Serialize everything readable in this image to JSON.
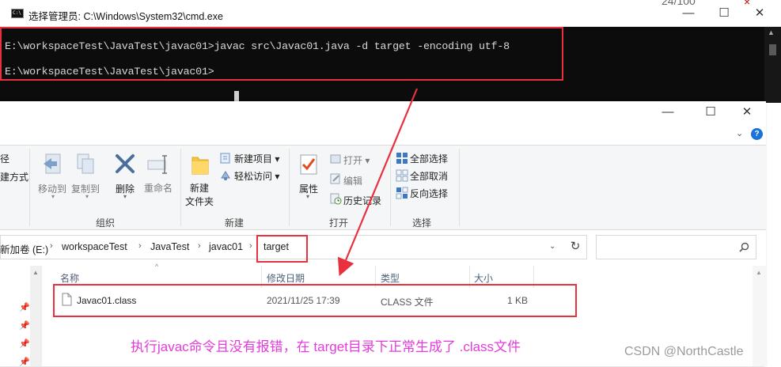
{
  "background_page": {
    "date_fragment": "24/100",
    "close_fragment": "×"
  },
  "cmd": {
    "app_icon_text": "C:\\",
    "title": "选择管理员: C:\\Windows\\System32\\cmd.exe",
    "minimize_glyph": "—",
    "maximize_glyph": "☐",
    "close_glyph": "✕",
    "lines": [
      "E:\\workspaceTest\\JavaTest\\javac01>javac src\\Javac01.java -d target -encoding utf-8",
      "E:\\workspaceTest\\JavaTest\\javac01>"
    ]
  },
  "explorer": {
    "window_controls": {
      "minimize": "—",
      "maximize": "☐",
      "close": "✕"
    },
    "ribbon_toggle": "⌄",
    "help": "?",
    "ribbon": {
      "left_fragment_1": "径",
      "left_fragment_2": "建方式",
      "organize": {
        "move_to": "移动到",
        "copy_to": "复制到",
        "delete": "删除",
        "rename": "重命名",
        "label": "组织"
      },
      "new": {
        "new_folder": "新建",
        "new_folder_line2": "文件夹",
        "new_item": "新建项目 ▾",
        "easy_access": "轻松访问 ▾",
        "label": "新建"
      },
      "open": {
        "properties": "属性",
        "open": "打开 ▾",
        "edit": "编辑",
        "history": "历史记录",
        "label": "打开"
      },
      "select": {
        "select_all": "全部选择",
        "select_none": "全部取消",
        "invert": "反向选择",
        "label": "选择"
      }
    },
    "address": {
      "crumbs": [
        "新加卷 (E:)",
        "workspaceTest",
        "JavaTest",
        "javac01",
        "target"
      ],
      "separator": "›",
      "dropdown": "⌄",
      "refresh": "↻"
    },
    "columns": [
      "名称",
      "修改日期",
      "类型",
      "大小"
    ],
    "sort_arrow": "^",
    "files": [
      {
        "name": "Javac01.class",
        "modified": "2021/11/25 17:39",
        "type": "CLASS 文件",
        "size": "1 KB"
      }
    ]
  },
  "annotation": {
    "caption": "执行javac命令且没有报错，在 target目录下正常生成了 .class文件",
    "watermark": "CSDN @NorthCastle"
  },
  "colors": {
    "annotation_red": "#e8303e",
    "annotation_magenta": "#e43bdc",
    "cmd_background": "#0c0c0c",
    "cmd_text": "#d9d9d9"
  }
}
